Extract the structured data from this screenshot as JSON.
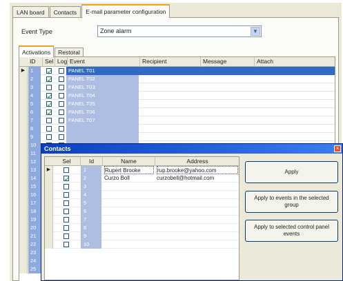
{
  "tabs": [
    "LAN board",
    "Contacts",
    "E-mail parameter configuration"
  ],
  "event_type": {
    "label": "Event Type",
    "value": "Zone alarm"
  },
  "subtabs": [
    "Activations",
    "Restoral"
  ],
  "grid": {
    "headers": [
      "ID",
      "Sel",
      "Log",
      "Event",
      "Recipient",
      "Message",
      "Attach"
    ],
    "rows": [
      {
        "id": "1",
        "sel": true,
        "log": false,
        "event": "PANEL T01",
        "selected": true
      },
      {
        "id": "2",
        "sel": true,
        "log": false,
        "event": "PANEL T02"
      },
      {
        "id": "3",
        "sel": false,
        "log": false,
        "event": "PANEL T03"
      },
      {
        "id": "4",
        "sel": true,
        "log": false,
        "event": "PANEL T04"
      },
      {
        "id": "5",
        "sel": true,
        "log": false,
        "event": "PANEL T05"
      },
      {
        "id": "6",
        "sel": true,
        "log": false,
        "event": "PANEL T06"
      },
      {
        "id": "7",
        "sel": false,
        "log": false,
        "event": "PANEL T07"
      },
      {
        "id": "8",
        "sel": false,
        "log": false,
        "event": ""
      },
      {
        "id": "9",
        "sel": false,
        "log": false,
        "event": ""
      },
      {
        "id": "10",
        "sel": false,
        "log": false,
        "event": ""
      },
      {
        "id": "11",
        "sel": false,
        "log": false,
        "event": ""
      },
      {
        "id": "12",
        "sel": false,
        "log": false,
        "event": ""
      },
      {
        "id": "13",
        "sel": false,
        "log": false,
        "event": ""
      },
      {
        "id": "14",
        "sel": false,
        "log": false,
        "event": ""
      },
      {
        "id": "15",
        "sel": false,
        "log": false,
        "event": ""
      },
      {
        "id": "16",
        "sel": false,
        "log": false,
        "event": ""
      },
      {
        "id": "17",
        "sel": false,
        "log": false,
        "event": ""
      },
      {
        "id": "18",
        "sel": false,
        "log": false,
        "event": ""
      },
      {
        "id": "19",
        "sel": false,
        "log": false,
        "event": ""
      },
      {
        "id": "20",
        "sel": false,
        "log": false,
        "event": ""
      },
      {
        "id": "21",
        "sel": false,
        "log": false,
        "event": ""
      },
      {
        "id": "22",
        "sel": false,
        "log": false,
        "event": ""
      },
      {
        "id": "23",
        "sel": false,
        "log": false,
        "event": ""
      },
      {
        "id": "24",
        "sel": false,
        "log": false,
        "event": ""
      },
      {
        "id": "25",
        "sel": false,
        "log": false,
        "event": ""
      }
    ]
  },
  "contacts": {
    "title": "Contacts",
    "headers": [
      "Sel",
      "Id",
      "Name",
      "Address"
    ],
    "rows": [
      {
        "sel": false,
        "id": "1",
        "name": "Rupert Brooke",
        "address": "rup.brooke@yahoo.com"
      },
      {
        "sel": true,
        "id": "2",
        "name": "Curzo Boll",
        "address": "curzobell@hotmail.com"
      },
      {
        "sel": false,
        "id": "3",
        "name": "",
        "address": ""
      },
      {
        "sel": false,
        "id": "4",
        "name": "",
        "address": ""
      },
      {
        "sel": false,
        "id": "5",
        "name": "",
        "address": ""
      },
      {
        "sel": false,
        "id": "6",
        "name": "",
        "address": ""
      },
      {
        "sel": false,
        "id": "7",
        "name": "",
        "address": ""
      },
      {
        "sel": false,
        "id": "8",
        "name": "",
        "address": ""
      },
      {
        "sel": false,
        "id": "9",
        "name": "",
        "address": ""
      },
      {
        "sel": false,
        "id": "10",
        "name": "",
        "address": ""
      }
    ],
    "buttons": {
      "apply": "Apply",
      "apply_group": "Apply to events in the selected group",
      "apply_panel": "Apply to selected control panel events"
    }
  },
  "colors": {
    "selection": "#316ac5",
    "id_cell": "#8ea9de",
    "title_bar": "#0a3fc0",
    "tab_highlight": "#e8a41c"
  }
}
